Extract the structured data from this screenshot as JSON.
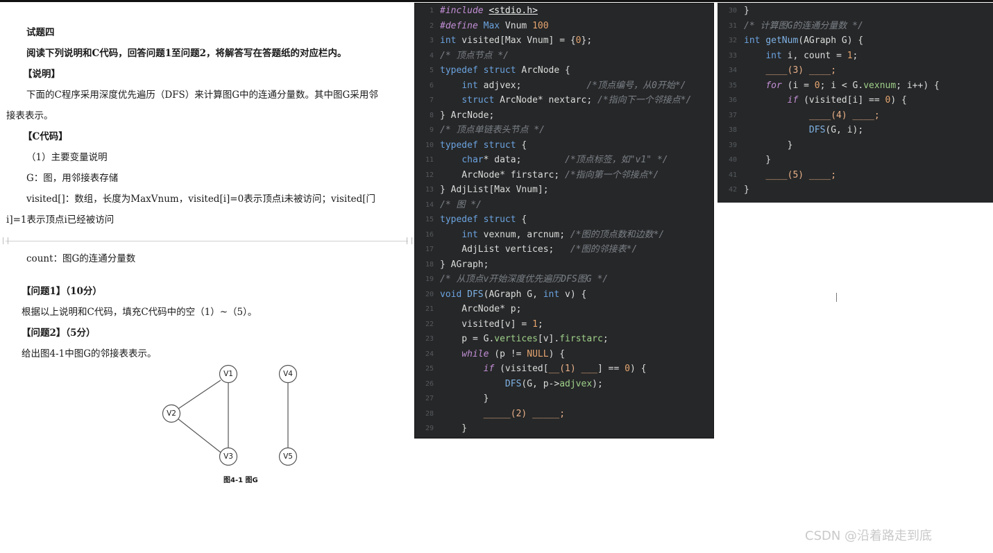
{
  "document": {
    "lines": [
      "试题四",
      "阅读下列说明和C代码，回答问题1至问题2，将解答写在答题纸的对应栏内。",
      "【说明】",
      "下面的C程序采用深度优先遍历（DFS）来计算图G中的连通分量数。其中图G采用邻",
      "接表表示。",
      "【C代码】",
      "（1）主要变量说明",
      "G：图，用邻接表存储",
      "visited[]：数组，长度为MaxVnum，visited[i]=0表示顶点i未被访问；visited[门",
      "i]=1表示顶点i已经被访问",
      "count：图G的连通分量数",
      "【问题1】（10分）",
      "根据以上说明和C代码，填充C代码中的空（1）~（5）。",
      "【问题2】（5分）",
      "给出图4-1中图G的邻接表表示。"
    ],
    "figure": {
      "nodes": [
        "V1",
        "V2",
        "V3",
        "V4",
        "V5"
      ],
      "caption": "图4-1  图G"
    }
  },
  "code_main": [
    {
      "n": "1",
      "t": "#include <stdio.h>"
    },
    {
      "n": "2",
      "t": "#define Max Vnum 100"
    },
    {
      "n": "3",
      "t": "int visited[Max Vnum] = {0};"
    },
    {
      "n": "4",
      "t": "/* 顶点节点 */"
    },
    {
      "n": "5",
      "t": "typedef struct ArcNode {"
    },
    {
      "n": "6",
      "t": "int adjvex;            /*顶点编号，从0开始*/"
    },
    {
      "n": "7",
      "t": "struct ArcNode* nextarc; /*指向下一个邻接点*/"
    },
    {
      "n": "8",
      "t": "} ArcNode;"
    },
    {
      "n": "9",
      "t": "/* 顶点单链表头节点 */"
    },
    {
      "n": "10",
      "t": "typedef struct {"
    },
    {
      "n": "11",
      "t": "char* data;        /*顶点标签，如\"v1\" */"
    },
    {
      "n": "12",
      "t": "ArcNode* firstarc; /*指向第一个邻接点*/"
    },
    {
      "n": "13",
      "t": "} AdjList[Max Vnum];"
    },
    {
      "n": "14",
      "t": "/* 图 */"
    },
    {
      "n": "15",
      "t": "typedef struct {"
    },
    {
      "n": "16",
      "t": "int vexnum, arcnum; /*图的顶点数和边数*/"
    },
    {
      "n": "17",
      "t": "AdjList vertices;   /*图的邻接表*/"
    },
    {
      "n": "18",
      "t": "} AGraph;"
    },
    {
      "n": "19",
      "t": "/* 从顶点v开始深度优先遍历DFS图G */"
    },
    {
      "n": "20",
      "t": "void DFS(AGraph G, int v) {"
    },
    {
      "n": "21",
      "t": "ArcNode* p;"
    },
    {
      "n": "22",
      "t": "visited[v] = 1;"
    },
    {
      "n": "23",
      "t": "p = G.vertices[v].firstarc;"
    },
    {
      "n": "24",
      "t": "while (p != NULL) {"
    },
    {
      "n": "25",
      "t": "if (visited[__(1) ___] == 0) {"
    },
    {
      "n": "26",
      "t": "DFS(G, p->adjvex);"
    },
    {
      "n": "27",
      "t": "}"
    },
    {
      "n": "28",
      "t": "_____(2) _____;"
    },
    {
      "n": "29",
      "t": "}"
    }
  ],
  "code_side": [
    {
      "n": "30",
      "t": "}"
    },
    {
      "n": "31",
      "t": "/* 计算图G的连通分量数 */"
    },
    {
      "n": "32",
      "t": "int getNum(AGraph G) {"
    },
    {
      "n": "33",
      "t": "int i, count = 1;"
    },
    {
      "n": "34",
      "t": "____(3) ____;"
    },
    {
      "n": "35",
      "t": "for (i = 0; i < G.vexnum; i++) {"
    },
    {
      "n": "36",
      "t": "if (visited[i] == 0) {"
    },
    {
      "n": "37",
      "t": "____(4) ____;"
    },
    {
      "n": "38",
      "t": "DFS(G, i);"
    },
    {
      "n": "39",
      "t": "}"
    },
    {
      "n": "40",
      "t": "}"
    },
    {
      "n": "41",
      "t": "____(5) ____;"
    },
    {
      "n": "42",
      "t": "}"
    }
  ],
  "watermark": "CSDN @沿着路走到底",
  "colors": {
    "panel_bg": "#262728",
    "keyword": "#6ba3e0",
    "control": "#c18fd6",
    "comment": "#7b8087",
    "number": "#e5a570",
    "member": "#9fd18a"
  }
}
